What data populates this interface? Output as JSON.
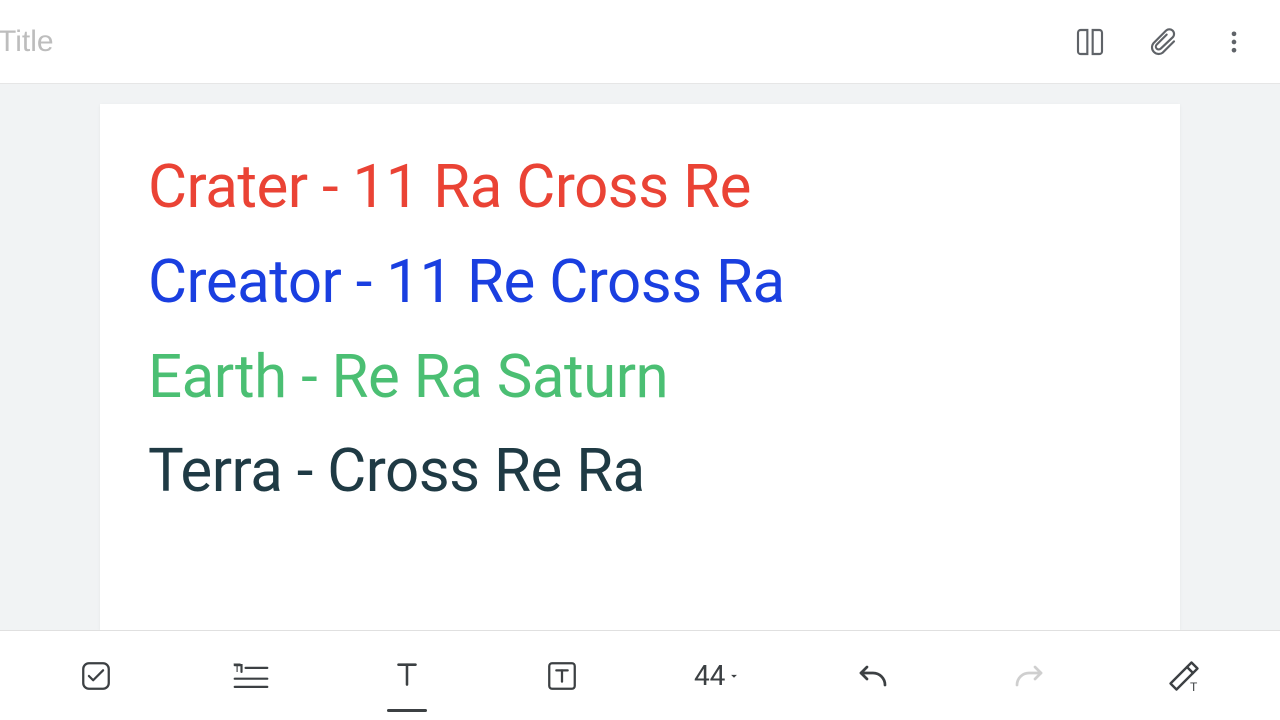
{
  "header": {
    "title_placeholder": "Title",
    "title_value": ""
  },
  "document": {
    "lines": [
      {
        "text": "Crater - 11 Ra Cross Re",
        "color": "#ea4335"
      },
      {
        "text": "Creator - 11 Re Cross Ra",
        "color": "#1a3fe0"
      },
      {
        "text": "Earth - Re Ra Saturn",
        "color": "#4bbf73"
      },
      {
        "text": "Terra - Cross Re Ra",
        "color": "#1f3a44"
      }
    ]
  },
  "toolbar": {
    "font_size": "44"
  }
}
